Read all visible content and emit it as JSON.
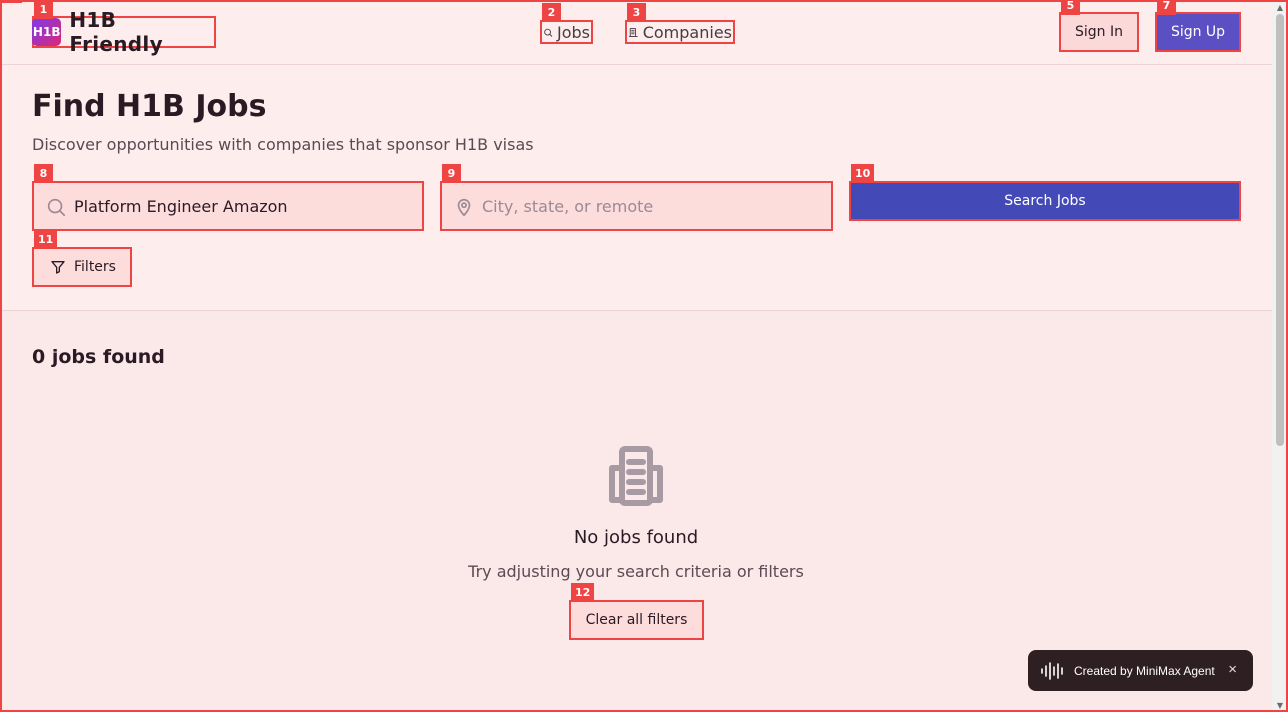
{
  "header": {
    "logo_text": "H1B",
    "brand_name": "H1B Friendly",
    "nav": {
      "jobs": "Jobs",
      "companies": "Companies"
    },
    "sign_in": "Sign In",
    "sign_up": "Sign Up"
  },
  "hero": {
    "title": "Find H1B Jobs",
    "subtitle": "Discover opportunities with companies that sponsor H1B visas",
    "keyword": {
      "value": "Platform Engineer Amazon"
    },
    "location": {
      "placeholder": "City, state, or remote",
      "value": ""
    },
    "search_button": "Search Jobs",
    "filters_button": "Filters"
  },
  "results": {
    "count_text": "0 jobs found",
    "empty_title": "No jobs found",
    "empty_subtitle": "Try adjusting your search criteria or filters",
    "clear_button": "Clear all filters"
  },
  "toast": {
    "text": "Created by MiniMax Agent",
    "close": "×"
  },
  "markers": [
    "1",
    "2",
    "3",
    "5",
    "7",
    "8",
    "9",
    "10",
    "11",
    "12"
  ],
  "colors": {
    "primary": "#4449b8",
    "signup": "#5b4fc4",
    "highlight": "#ef4444",
    "background": "#fbe9e9"
  }
}
